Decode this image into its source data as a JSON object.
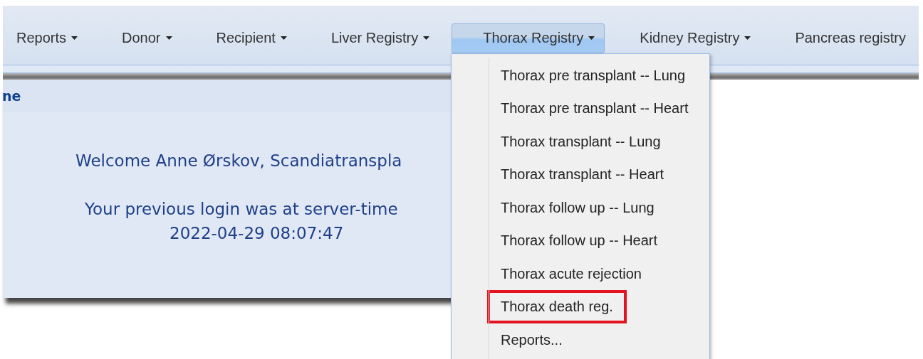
{
  "menubar": {
    "items": [
      {
        "label": "Reports",
        "caret": true,
        "selected": false
      },
      {
        "label": "Donor",
        "caret": true,
        "selected": false
      },
      {
        "label": "Recipient",
        "caret": true,
        "selected": false
      },
      {
        "label": "Liver Registry",
        "caret": true,
        "selected": false
      },
      {
        "label": "Thorax Registry",
        "caret": true,
        "selected": true
      },
      {
        "label": "Kidney Registry",
        "caret": true,
        "selected": false
      },
      {
        "label": "Pancreas registry",
        "caret": false,
        "selected": false
      }
    ]
  },
  "panel": {
    "title": "ne",
    "lines": [
      "Welcome Anne Ørskov, Scandiatranspla",
      "Your previous login was at server-time",
      "2022-04-29 08:07:47"
    ]
  },
  "dropdown": {
    "items": [
      {
        "label": "Thorax pre transplant -- Lung",
        "highlighted": false
      },
      {
        "label": "Thorax pre transplant -- Heart",
        "highlighted": false
      },
      {
        "label": "Thorax transplant -- Lung",
        "highlighted": false
      },
      {
        "label": "Thorax transplant -- Heart",
        "highlighted": false
      },
      {
        "label": "Thorax follow up -- Lung",
        "highlighted": false
      },
      {
        "label": "Thorax follow up -- Heart",
        "highlighted": false
      },
      {
        "label": "Thorax acute rejection",
        "highlighted": false
      },
      {
        "label": "Thorax death reg.",
        "highlighted": true
      },
      {
        "label": "Reports...",
        "highlighted": false
      }
    ]
  }
}
